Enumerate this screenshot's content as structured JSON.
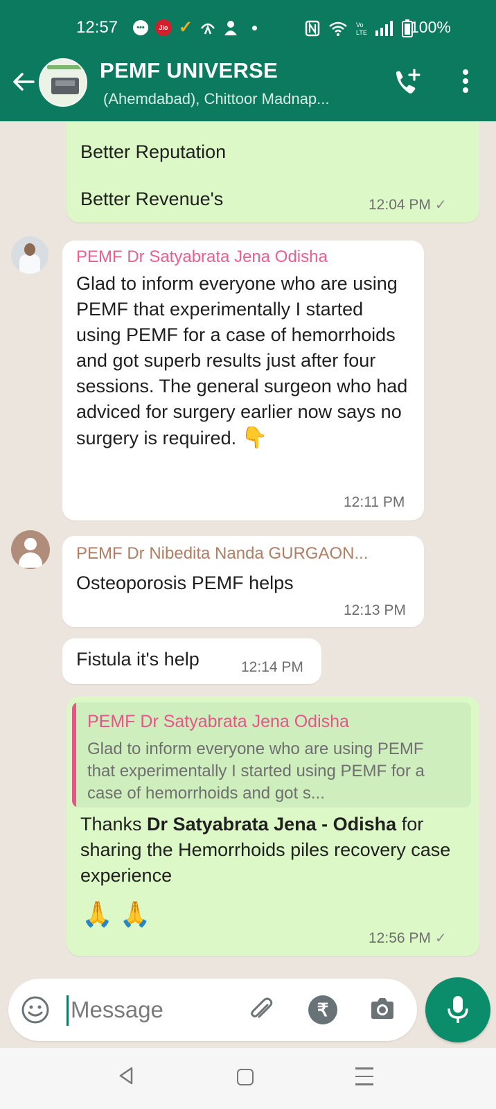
{
  "status_bar": {
    "time": "12:57",
    "jio_label": "Jio",
    "battery": "100%"
  },
  "header": {
    "title": "PEMF UNIVERSE",
    "subtitle": "(Ahemdabad),  Chittoor Madnap..."
  },
  "messages": [
    {
      "type": "outgoing",
      "lines": [
        "Better Reputation",
        "Better Revenue's"
      ],
      "time": "12:04 PM"
    },
    {
      "type": "incoming",
      "sender": "PEMF Dr Satyabrata Jena Odisha",
      "sender_color": "#e8608e",
      "text": "Glad to inform everyone who are using PEMF that experimentally I started using PEMF for a case of hemorrhoids and got superb results just after four sessions. The general surgeon who had adviced  for surgery earlier now says no surgery is required.",
      "emoji": "👇",
      "time": "12:11 PM"
    },
    {
      "type": "incoming",
      "sender": "PEMF Dr Nibedita Nanda GURGAON...",
      "sender_color": "#b07e63",
      "text": "Osteoporosis PEMF helps",
      "time": "12:13 PM"
    },
    {
      "type": "incoming",
      "text": "Fistula it's help",
      "time": "12:14 PM"
    },
    {
      "type": "outgoing",
      "quote_sender": "PEMF Dr Satyabrata Jena Odisha",
      "quote_text": "Glad to inform everyone who are using PEMF that experimentally I started using PEMF for a case of hemorrhoids and got s...",
      "text_prefix": "Thanks ",
      "text_bold": "Dr Satyabrata Jena - Odisha",
      "text_suffix": " for sharing the Hemorrhoids piles recovery case experience",
      "emoji": "🙏 🙏",
      "time": "12:56 PM"
    }
  ],
  "composer": {
    "placeholder": "Message",
    "currency_symbol": "₹"
  },
  "colors": {
    "brand": "#0b7a5e",
    "outgoing_bubble": "#dcf8c6",
    "incoming_bubble": "#ffffff",
    "mic_button": "#0b8d6b"
  }
}
